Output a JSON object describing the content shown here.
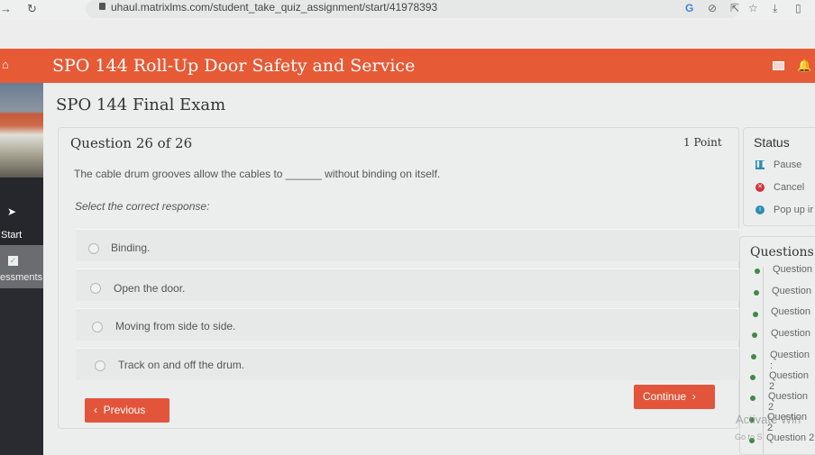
{
  "browser": {
    "url": "uhaul.matrixlms.com/student_take_quiz_assignment/start/41978393",
    "back_icon": "arrow-right",
    "reload_icon": "reload"
  },
  "header": {
    "course_title": "SPO 144 Roll-Up Door Safety and Service",
    "accent_color": "#e65a36"
  },
  "sidebar": {
    "items": [
      {
        "label": "Start",
        "icon": "navigation-arrow-icon"
      },
      {
        "label": "essments",
        "icon": "checkbox-icon"
      }
    ]
  },
  "main": {
    "exam_title": "SPO 144 Final Exam",
    "question": {
      "number_label": "Question 26 of 26",
      "points": "1 Point",
      "text": "The cable drum grooves allow the cables to ______ without binding on itself.",
      "instruction": "Select the correct response:",
      "options": [
        {
          "label": "Binding."
        },
        {
          "label": "Open the door."
        },
        {
          "label": "Moving from side to side."
        },
        {
          "label": "Track on and off the drum."
        }
      ]
    },
    "buttons": {
      "previous": "Previous",
      "continue": "Continue"
    }
  },
  "status": {
    "title": "Status",
    "items": [
      {
        "label": "Pause",
        "icon": "pause-icon",
        "color": "#2d8fb0"
      },
      {
        "label": "Cancel",
        "icon": "cancel-icon",
        "color": "#d2343f"
      },
      {
        "label": "Pop up ir",
        "icon": "info-icon",
        "color": "#2d8fb0"
      }
    ]
  },
  "questions_panel": {
    "title": "Questions",
    "items": [
      {
        "label": "Question"
      },
      {
        "label": "Question"
      },
      {
        "label": "Question"
      },
      {
        "label": "Question"
      },
      {
        "label": "Question :"
      },
      {
        "label": "Question 2"
      },
      {
        "label": "Question 2"
      },
      {
        "label": "Question 2"
      },
      {
        "label": "Question 2"
      }
    ]
  },
  "watermark": {
    "line1": "Activate Win",
    "line2": "Go to S"
  }
}
